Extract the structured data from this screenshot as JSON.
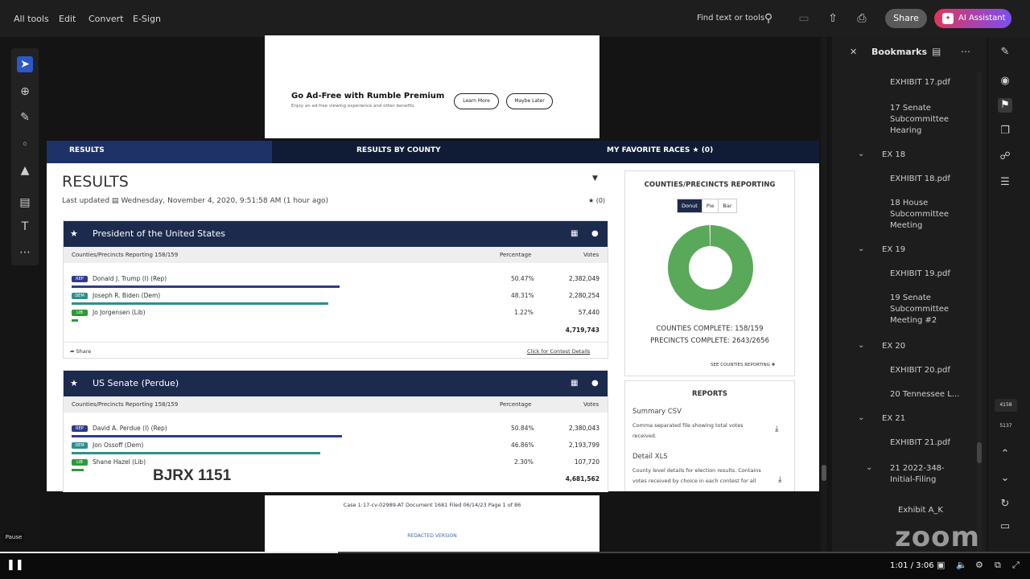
{
  "menu": {
    "all_tools": "All tools",
    "edit": "Edit",
    "convert": "Convert",
    "esign": "E-Sign"
  },
  "toolbar": {
    "find": "Find text or tools",
    "share": "Share",
    "ai": "AI Assistant"
  },
  "ad": {
    "title": "Go Ad-Free with Rumble Premium",
    "subtitle": "Enjoy an ad-free viewing experience and other benefits",
    "learn_more": "Learn More",
    "maybe_later": "Maybe Later"
  },
  "tabs": {
    "results": "RESULTS",
    "by_county": "RESULTS BY COUNTY",
    "favorites": "MY FAVORITE RACES ★ (0)"
  },
  "page": {
    "title": "RESULTS",
    "updated_label": "Last updated",
    "updated": "Wednesday, November 4, 2020, 9:51:58 AM",
    "ago": "(1 hour ago)",
    "fav_count": "★ (0)"
  },
  "races": [
    {
      "title": "President of the United States",
      "reporting": "Counties/Precincts Reporting 158/159",
      "pct_header": "Percentage",
      "votes_header": "Votes",
      "candidates": [
        {
          "name": "Donald J. Trump (I) (Rep)",
          "pct": "50.47%",
          "votes": "2,382,049",
          "tag": "REP",
          "color": "#2f3a8f",
          "share": 0.5047
        },
        {
          "name": "Joseph R. Biden (Dem)",
          "pct": "48.31%",
          "votes": "2,280,254",
          "tag": "DEM",
          "color": "#2f8f8a",
          "share": 0.4831
        },
        {
          "name": "Jo Jorgensen (Lib)",
          "pct": "1.22%",
          "votes": "57,440",
          "tag": "LIB",
          "color": "#2e9a3a",
          "share": 0.0122
        }
      ],
      "total": "4,719,743",
      "share_label": "Share",
      "details_label": "Click for Contest Details"
    },
    {
      "title": "US Senate (Perdue)",
      "reporting": "Counties/Precincts Reporting 158/159",
      "pct_header": "Percentage",
      "votes_header": "Votes",
      "candidates": [
        {
          "name": "David A. Perdue (I) (Rep)",
          "pct": "50.84%",
          "votes": "2,380,043",
          "tag": "REP",
          "color": "#2f3a8f",
          "share": 0.5084
        },
        {
          "name": "Jon Ossoff (Dem)",
          "pct": "46.86%",
          "votes": "2,193,799",
          "tag": "DEM",
          "color": "#2f8f8a",
          "share": 0.4686
        },
        {
          "name": "Shane Hazel (Lib)",
          "pct": "2.30%",
          "votes": "107,720",
          "tag": "LIB",
          "color": "#2e9a3a",
          "share": 0.023
        }
      ],
      "total": "4,681,562"
    }
  ],
  "reporting_card": {
    "title": "COUNTIES/PRECINCTS REPORTING",
    "toggles": [
      "Donut",
      "Pie",
      "Bar"
    ],
    "counties": "COUNTIES COMPLETE: 158/159",
    "precincts": "PRECINCTS COMPLETE: 2643/2656",
    "see_link": "SEE COUNTIES REPORTING",
    "complete_share": 0.994
  },
  "reports": {
    "title": "REPORTS",
    "csv_title": "Summary CSV",
    "csv_desc": "Comma separated file showing total votes received.",
    "xls_title": "Detail XLS",
    "xls_desc": "County level details for election results. Contains votes received by choice in each contest for all"
  },
  "watermark": "BJRX 1151",
  "footer": {
    "case": "Case 1:17-cv-02989-AT   Document 1681   Filed 06/14/23   Page 1 of 86",
    "redacted": "REDACTED VERSION"
  },
  "bookmarks": {
    "title": "Bookmarks",
    "items": [
      {
        "label": "EXHIBIT 17.pdf",
        "level": 2
      },
      {
        "label": "17 Senate Subcommittee Hearing",
        "level": 2
      },
      {
        "label": "EX 18",
        "level": 1
      },
      {
        "label": "EXHIBIT 18.pdf",
        "level": 2
      },
      {
        "label": "18 House Subcommittee Meeting",
        "level": 2
      },
      {
        "label": "EX 19",
        "level": 1
      },
      {
        "label": "EXHIBIT 19.pdf",
        "level": 2
      },
      {
        "label": "19 Senate Subcommittee Meeting #2",
        "level": 2
      },
      {
        "label": "EX 20",
        "level": 1
      },
      {
        "label": "EXHIBIT 20.pdf",
        "level": 2
      },
      {
        "label": "20 Tennessee L...",
        "level": 2
      },
      {
        "label": "EX 21",
        "level": 1
      },
      {
        "label": "EXHIBIT 21.pdf",
        "level": 2
      },
      {
        "label": "21 2022-348-Initial-Filing",
        "level": 2
      },
      {
        "label": "Exhibit A_K",
        "level": 3
      }
    ]
  },
  "page_nums": {
    "current": "4158",
    "total": "5137"
  },
  "player": {
    "pause_tip": "Pause",
    "time": "1:01 / 3:06",
    "progress": 0.328,
    "brand": "zoom"
  }
}
